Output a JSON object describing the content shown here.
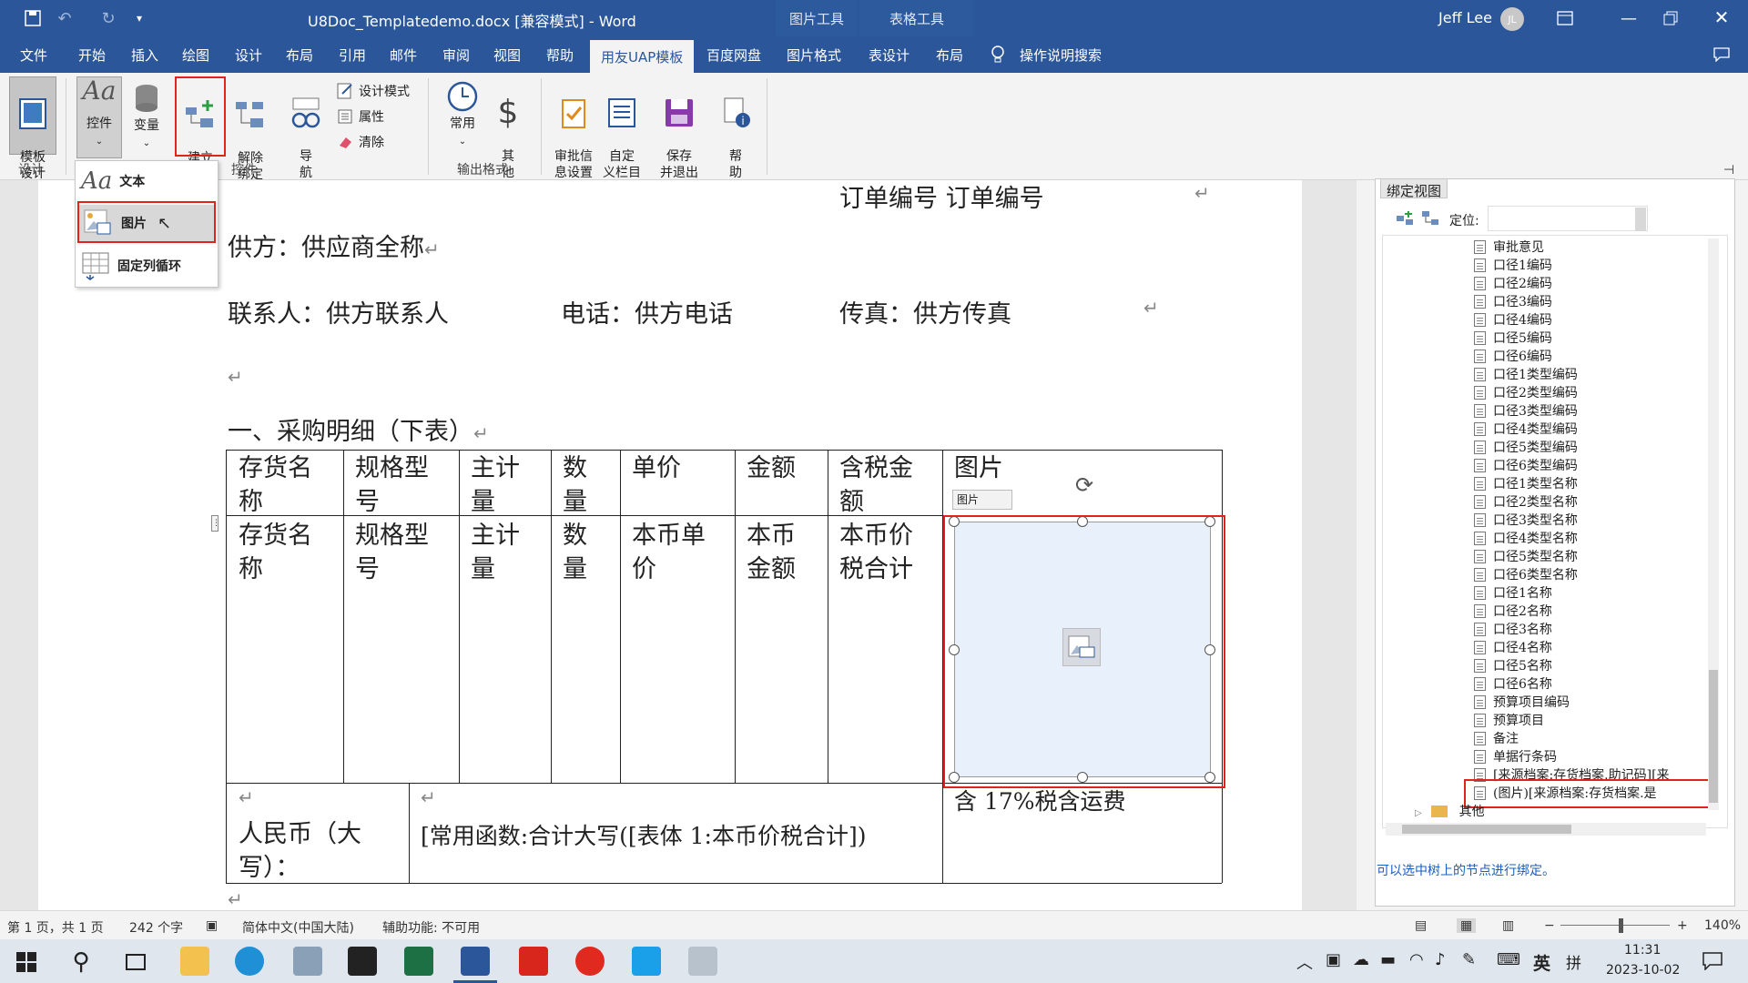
{
  "titlebar": {
    "quick_access_hint": "Quick Access Toolbar",
    "doc_title": "U8Doc_Templatedemo.docx [兼容模式]  -  Word",
    "context_picture_tools": "图片工具",
    "context_table_tools": "表格工具",
    "user_name": "Jeff Lee",
    "user_initials": "JL"
  },
  "tabs": [
    "文件",
    "开始",
    "插入",
    "绘图",
    "设计",
    "布局",
    "引用",
    "邮件",
    "审阅",
    "视图",
    "帮助",
    "用友UAP模板",
    "百度网盘",
    "图片格式",
    "表设计",
    "布局"
  ],
  "tell_me": "操作说明搜索",
  "ribbon": {
    "template_design": "模板\n设计",
    "controls": "控件",
    "variables": "变量",
    "build_binding": "建立\n绑定",
    "remove_binding": "解除\n绑定",
    "navigate": "导\n航",
    "design_mode": "设计模式",
    "properties": "属性",
    "clear": "清除",
    "common": "常用",
    "other": "其\n他",
    "approval_info": "审批信\n息设置",
    "custom_doc": "自定\n义栏目",
    "save_exit": "保存\n并退出",
    "help": "帮\n助",
    "group_design": "设计",
    "group_controls": "控件",
    "group_output": "输出格式"
  },
  "dropdown": {
    "text_item": "文本",
    "picture_item": "图片",
    "loop_item": "固定列循环"
  },
  "document": {
    "order_no": "订单编号  订单编号",
    "supplier": "供方：供应商全称",
    "contact": "联系人：供方联系人",
    "phone": "电话：供方电话",
    "fax": "传真：供方传真",
    "section_heading": "一、采购明细（下表）",
    "table_headers": [
      "存货名\n称",
      "规格型\n号",
      "主计\n量",
      "数\n量",
      "单价",
      "金额",
      "含税金\n额",
      "图片"
    ],
    "table_row": [
      "存货名\n称",
      "规格型\n号",
      "主计\n量",
      "数\n量",
      "本币单\n价",
      "本币\n金额",
      "本币价\n税合计"
    ],
    "picture_control_label": "图片",
    "total_label": "人民币（大\n写）：",
    "total_formula": "[常用函数:合计大写([表体 1:本币价税合计])",
    "tax_note": "含 17%税含运费"
  },
  "pane": {
    "tab_title": "绑定视图",
    "locate_label": "定位:",
    "tree_items": [
      "审批意见",
      "口径1编码",
      "口径2编码",
      "口径3编码",
      "口径4编码",
      "口径5编码",
      "口径6编码",
      "口径1类型编码",
      "口径2类型编码",
      "口径3类型编码",
      "口径4类型编码",
      "口径5类型编码",
      "口径6类型编码",
      "口径1类型名称",
      "口径2类型名称",
      "口径3类型名称",
      "口径4类型名称",
      "口径5类型名称",
      "口径6类型名称",
      "口径1名称",
      "口径2名称",
      "口径3名称",
      "口径4名称",
      "口径5名称",
      "口径6名称",
      "预算项目编码",
      "预算项目",
      "备注",
      "单据行条码",
      "[来源档案:存货档案.助记码][来",
      "(图片)[来源档案:存货档案.是"
    ],
    "folder_other": "其他",
    "hint": "可以选中树上的节点进行绑定。"
  },
  "status": {
    "page": "第 1 页，共 1 页",
    "words": "242 个字",
    "language": "简体中文(中国大陆)",
    "accessibility": "辅助功能: 不可用",
    "zoom": "140%"
  },
  "taskbar": {
    "ime1": "英",
    "ime2": "拼",
    "time": "11:31",
    "date": "2023-10-02"
  },
  "colors": {
    "accent": "#2b579a",
    "highlight": "#e0241b",
    "picture_fill": "#e8f0fc"
  }
}
